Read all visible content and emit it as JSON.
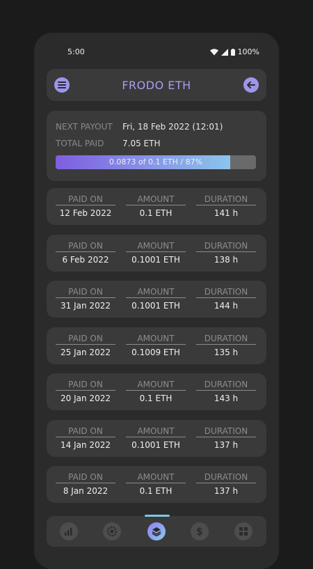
{
  "status_bar": {
    "time": "5:00",
    "battery": "100%"
  },
  "header": {
    "title": "FRODO ETH"
  },
  "summary": {
    "next_payout_label": "NEXT PAYOUT",
    "next_payout_value": "Fri, 18 Feb 2022 (12:01)",
    "total_paid_label": "TOTAL PAID",
    "total_paid_value": "7.05 ETH",
    "progress_text": "0.0873 of 0.1 ETH / 87%",
    "progress_percent": 87
  },
  "columns": {
    "paid_on": "PAID ON",
    "amount": "AMOUNT",
    "duration": "DURATION"
  },
  "payments": [
    {
      "paid_on": "12 Feb 2022",
      "amount": "0.1 ETH",
      "duration": "141 h"
    },
    {
      "paid_on": "6 Feb 2022",
      "amount": "0.1001 ETH",
      "duration": "138 h"
    },
    {
      "paid_on": "31 Jan 2022",
      "amount": "0.1001 ETH",
      "duration": "144 h"
    },
    {
      "paid_on": "25 Jan 2022",
      "amount": "0.1009 ETH",
      "duration": "135 h"
    },
    {
      "paid_on": "20 Jan 2022",
      "amount": "0.1 ETH",
      "duration": "143 h"
    },
    {
      "paid_on": "14 Jan 2022",
      "amount": "0.1001 ETH",
      "duration": "137 h"
    },
    {
      "paid_on": "8 Jan 2022",
      "amount": "0.1 ETH",
      "duration": "137 h"
    }
  ],
  "nav": {
    "items": [
      "chart-icon",
      "gear-icon",
      "layers-icon",
      "dollar-icon",
      "dashboard-icon"
    ],
    "active": "layers-icon"
  },
  "colors": {
    "accent": "#a79ef3",
    "progress_start": "#7f5ee0",
    "progress_end": "#8cc4ec"
  }
}
